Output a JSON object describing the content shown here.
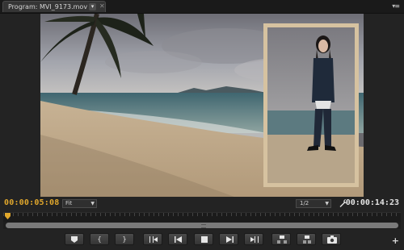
{
  "panel": {
    "tab_title": "Program: MVI_9173.mov",
    "dropdown_icon": "chevron-down-icon",
    "close_icon": "close-icon",
    "menu_icon": "panel-menu-icon"
  },
  "viewer": {
    "current_timecode": "00:00:05:08",
    "duration_timecode": "00:00:14:23",
    "zoom_level": "Fit",
    "playback_resolution": "1/2",
    "settings_icon": "wrench-icon"
  },
  "transport": {
    "buttons": [
      {
        "name": "add-marker-button",
        "icon": "marker-icon"
      },
      {
        "name": "mark-in-button",
        "icon": "mark-in-icon",
        "glyph": "{"
      },
      {
        "name": "mark-out-button",
        "icon": "mark-out-icon",
        "glyph": "}"
      },
      {
        "name": "go-to-in-button",
        "icon": "go-to-in-icon"
      },
      {
        "name": "step-back-button",
        "icon": "step-back-icon"
      },
      {
        "name": "stop-button",
        "icon": "stop-icon"
      },
      {
        "name": "step-forward-button",
        "icon": "step-forward-icon"
      },
      {
        "name": "go-to-out-button",
        "icon": "go-to-out-icon"
      },
      {
        "name": "lift-button",
        "icon": "lift-icon"
      },
      {
        "name": "extract-button",
        "icon": "extract-icon"
      },
      {
        "name": "export-frame-button",
        "icon": "camera-icon"
      }
    ],
    "add_button_label": "+"
  },
  "colors": {
    "timecode_accent": "#e2a82c",
    "panel_bg": "#232323"
  }
}
